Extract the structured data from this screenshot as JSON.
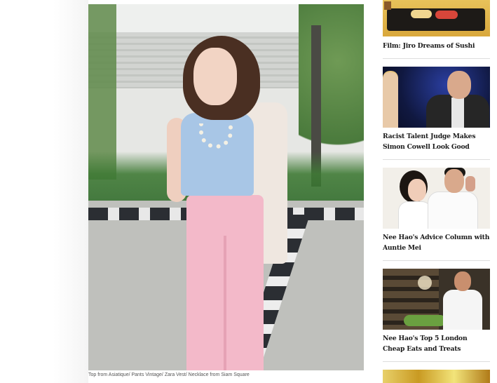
{
  "article": {
    "caption": "Top from Asiatique/ Pants Vintage/ Zara Vest/ Necklace from Siam Square"
  },
  "sidebar": {
    "items": [
      {
        "title": "Film: Jiro Dreams of Sushi"
      },
      {
        "title": "Racist Talent Judge Makes Simon Cowell Look Good"
      },
      {
        "title": "Nee Hao's Advice Column with Auntie Mei"
      },
      {
        "title": "Nee Hao's Top 5 London Cheap Eats and Treats"
      }
    ]
  }
}
